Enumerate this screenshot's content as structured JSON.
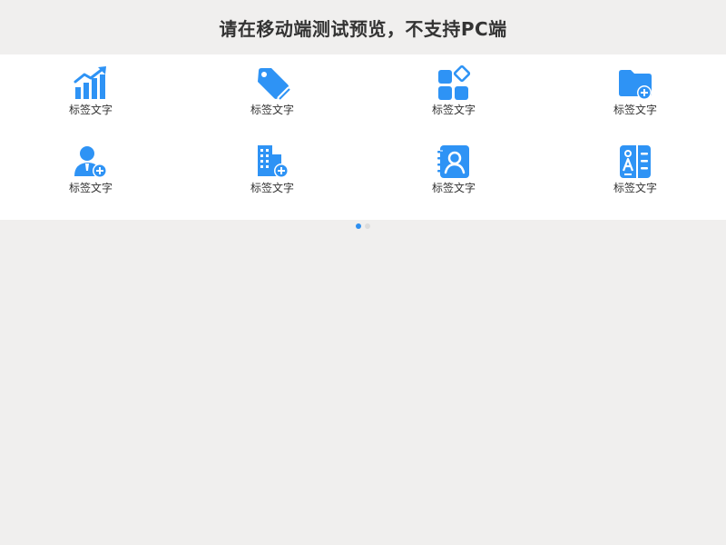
{
  "notice": "请在移动端测试预览，不支持PC端",
  "accent_color": "#2E93F5",
  "grid": {
    "items": [
      {
        "label": "标签文字",
        "icon": "chart-trending-icon"
      },
      {
        "label": "标签文字",
        "icon": "tag-icon"
      },
      {
        "label": "标签文字",
        "icon": "apps-icon"
      },
      {
        "label": "标签文字",
        "icon": "folder-add-icon"
      },
      {
        "label": "标签文字",
        "icon": "user-add-icon"
      },
      {
        "label": "标签文字",
        "icon": "building-add-icon"
      },
      {
        "label": "标签文字",
        "icon": "contacts-book-icon"
      },
      {
        "label": "标签文字",
        "icon": "profile-card-icon"
      }
    ]
  },
  "pager": {
    "current": 1,
    "total": 2
  }
}
